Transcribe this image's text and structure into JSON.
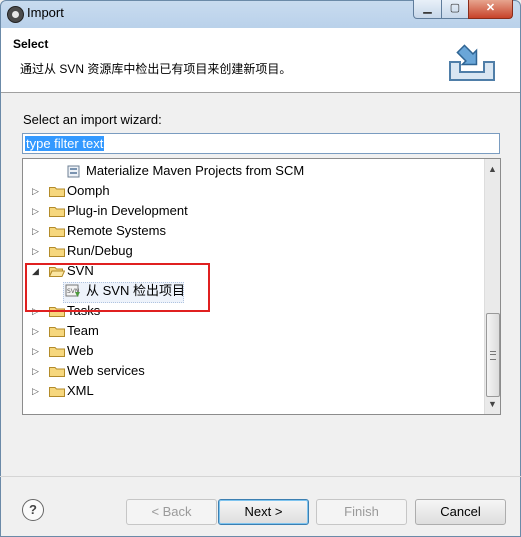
{
  "window": {
    "title": "Import"
  },
  "banner": {
    "title": "Select",
    "description": "通过从 SVN 资源库中检出已有项目来创建新项目。"
  },
  "wizard": {
    "label": "Select an import wizard:",
    "filter_value": "type filter text"
  },
  "tree": {
    "items": [
      {
        "label": "Materialize Maven Projects from SCM",
        "expanded": false,
        "level": 1
      },
      {
        "label": "Oomph",
        "expanded": false,
        "level": 0
      },
      {
        "label": "Plug-in Development",
        "expanded": false,
        "level": 0
      },
      {
        "label": "Remote Systems",
        "expanded": false,
        "level": 0
      },
      {
        "label": "Run/Debug",
        "expanded": false,
        "level": 0
      },
      {
        "label": "SVN",
        "expanded": true,
        "level": 0
      },
      {
        "label": "从 SVN 检出项目",
        "expanded": false,
        "level": 1
      },
      {
        "label": "Tasks",
        "expanded": false,
        "level": 0
      },
      {
        "label": "Team",
        "expanded": false,
        "level": 0
      },
      {
        "label": "Web",
        "expanded": false,
        "level": 0
      },
      {
        "label": "Web services",
        "expanded": false,
        "level": 0
      },
      {
        "label": "XML",
        "expanded": false,
        "level": 0
      }
    ]
  },
  "buttons": {
    "back": "< Back",
    "next": "Next >",
    "finish": "Finish",
    "cancel": "Cancel",
    "help": "?"
  },
  "colors": {
    "highlight_box": "#e02020",
    "selection": "#3399ff"
  }
}
